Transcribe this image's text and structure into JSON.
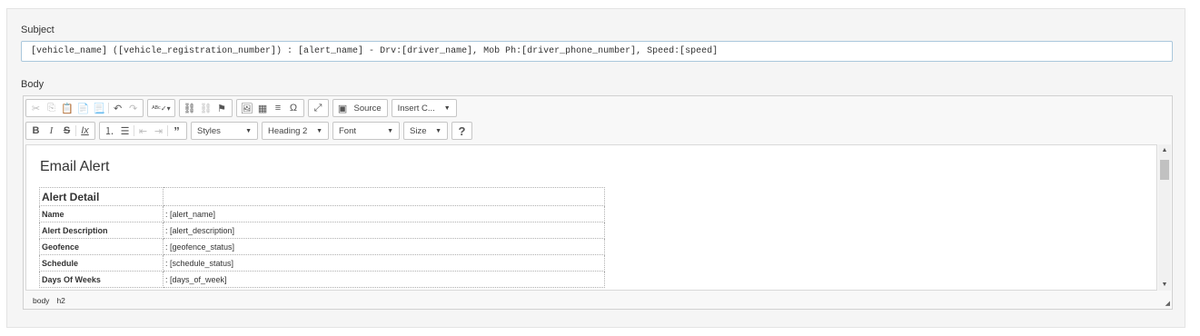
{
  "subject": {
    "label": "Subject",
    "value": "[vehicle_name] ([vehicle_registration_number]) : [alert_name] - Drv:[driver_name], Mob Ph:[driver_phone_number], Speed:[speed]"
  },
  "body": {
    "label": "Body",
    "toolbar": {
      "source_label": "Source",
      "insert_label": "Insert C...",
      "styles_label": "Styles",
      "format_label": "Heading 2",
      "font_label": "Font",
      "size_label": "Size",
      "help_label": "?"
    },
    "content": {
      "heading": "Email Alert",
      "table_header": "Alert Detail",
      "rows": [
        {
          "label": "Name",
          "value": ": [alert_name]"
        },
        {
          "label": "Alert Description",
          "value": ": [alert_description]"
        },
        {
          "label": "Geofence",
          "value": ": [geofence_status]"
        },
        {
          "label": "Schedule",
          "value": ": [schedule_status]"
        },
        {
          "label": "Days Of Weeks",
          "value": ": [days_of_week]"
        }
      ]
    },
    "elements_path": [
      "body",
      "h2"
    ]
  }
}
